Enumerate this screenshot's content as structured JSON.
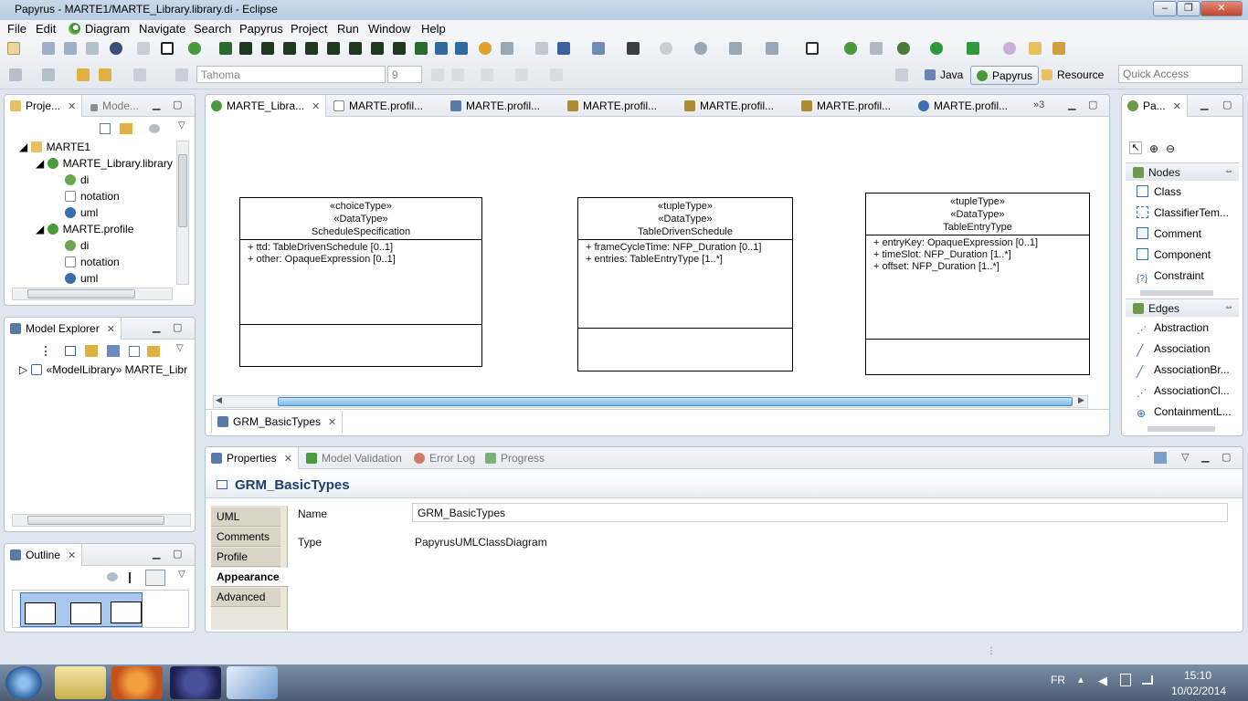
{
  "window": {
    "title": "Papyrus - MARTE1/MARTE_Library.library.di - Eclipse",
    "min": "–",
    "max": "❐",
    "close": "✕"
  },
  "menu": [
    "File",
    "Edit",
    "Diagram",
    "Navigate",
    "Search",
    "Papyrus",
    "Project",
    "Run",
    "Window",
    "Help"
  ],
  "toolbar": {
    "font_name": "Tahoma",
    "font_size": "9",
    "quick_access": "Quick Access"
  },
  "perspectives": {
    "java": "Java",
    "papyrus": "Papyrus",
    "resource": "Resource"
  },
  "project_explorer": {
    "tab_label": "Proje...",
    "other_tab": "Mode...",
    "tree": [
      {
        "label": "MARTE1",
        "level": 0,
        "icon": "folder-icon"
      },
      {
        "label": "MARTE_Library.library",
        "level": 1,
        "icon": "papyrus-model-icon"
      },
      {
        "label": "di",
        "level": 2,
        "icon": "di-file-icon"
      },
      {
        "label": "notation",
        "level": 2,
        "icon": "notation-file-icon"
      },
      {
        "label": "uml",
        "level": 2,
        "icon": "uml-file-icon"
      },
      {
        "label": "MARTE.profile",
        "level": 1,
        "icon": "papyrus-model-icon"
      },
      {
        "label": "di",
        "level": 2,
        "icon": "di-file-icon"
      },
      {
        "label": "notation",
        "level": 2,
        "icon": "notation-file-icon"
      },
      {
        "label": "uml",
        "level": 2,
        "icon": "uml-file-icon"
      }
    ]
  },
  "model_explorer": {
    "tab_label": "Model Explorer",
    "root": "«ModelLibrary» MARTE_Libr"
  },
  "outline": {
    "tab_label": "Outline"
  },
  "editor": {
    "tabs": [
      "MARTE_Libra...",
      "MARTE.profil...",
      "MARTE.profil...",
      "MARTE.profil...",
      "MARTE.profil...",
      "MARTE.profil...",
      "MARTE.profil..."
    ],
    "overflow": "»3",
    "diagram_tab": "GRM_BasicTypes",
    "classes": [
      {
        "stereotypes": [
          "«choiceType»",
          "«DataType»"
        ],
        "name": "ScheduleSpecification",
        "attrs": [
          "+ ttd: TableDrivenSchedule [0..1]",
          "+ other: OpaqueExpression [0..1]"
        ]
      },
      {
        "stereotypes": [
          "«tupleType»",
          "«DataType»"
        ],
        "name": "TableDrivenSchedule",
        "attrs": [
          "+ frameCycleTime: NFP_Duration [0..1]",
          "+ entries: TableEntryType [1..*]"
        ]
      },
      {
        "stereotypes": [
          "«tupleType»",
          "«DataType»"
        ],
        "name": "TableEntryType",
        "attrs": [
          "+ entryKey: OpaqueExpression [0..1]",
          "+ timeSlot: NFP_Duration [1..*]",
          "+ offset: NFP_Duration [1..*]"
        ]
      }
    ]
  },
  "palette": {
    "tab_label": "Pa...",
    "nodes_label": "Nodes",
    "nodes": [
      "Class",
      "ClassifierTem...",
      "Comment",
      "Component",
      "Constraint"
    ],
    "edges_label": "Edges",
    "edges": [
      "Abstraction",
      "Association",
      "AssociationBr...",
      "AssociationCl...",
      "ContainmentL..."
    ]
  },
  "properties": {
    "tabs": [
      "Properties",
      "Model Validation",
      "Error Log",
      "Progress"
    ],
    "title": "GRM_BasicTypes",
    "side_tabs": [
      "UML",
      "Comments",
      "Profile",
      "Appearance",
      "Advanced"
    ],
    "active_side_tab": "Appearance",
    "name_label": "Name",
    "name_value": "GRM_BasicTypes",
    "type_label": "Type",
    "type_value": "PapyrusUMLClassDiagram"
  },
  "taskbar": {
    "lang": "FR",
    "time": "15:10",
    "date": "10/02/2014"
  }
}
